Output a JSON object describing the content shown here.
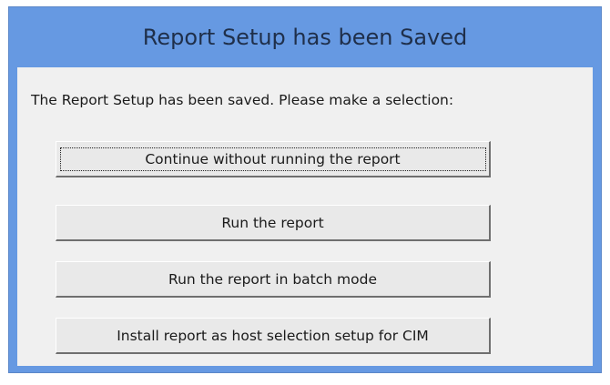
{
  "dialog": {
    "title": "Report Setup has been Saved",
    "message": "The Report Setup has been saved.  Please make a selection:",
    "buttons": [
      {
        "label": "Continue without running the report",
        "focused": true
      },
      {
        "label": "Run the report",
        "focused": false
      },
      {
        "label": "Run the report in batch mode",
        "focused": false
      },
      {
        "label": "Install report as host selection setup for CIM",
        "focused": false
      }
    ]
  },
  "colors": {
    "title_bar": "#6699e2",
    "client_background": "#f0f0f0",
    "button_face": "#e9e9e9"
  }
}
